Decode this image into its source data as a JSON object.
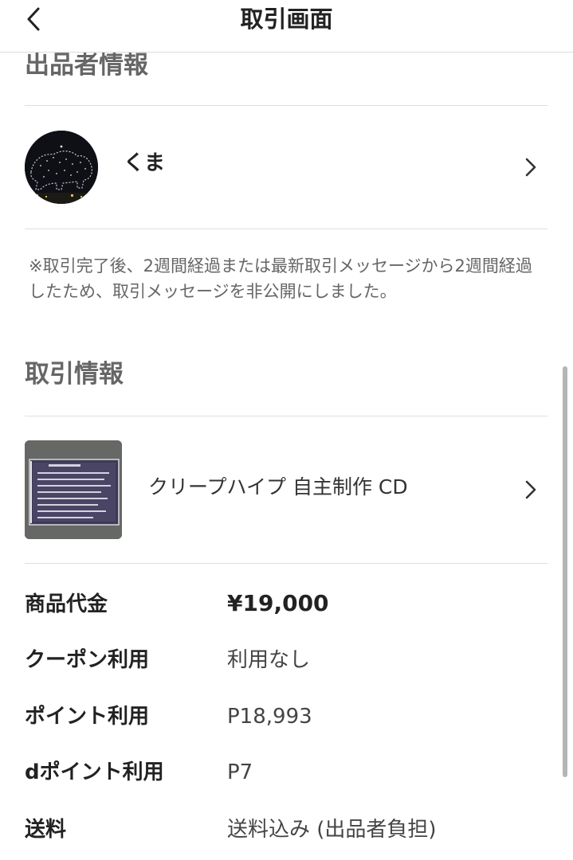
{
  "header": {
    "title": "取引画面"
  },
  "seller_section": {
    "title": "出品者情報",
    "seller_name": "くま"
  },
  "notice": "※取引完了後、2週間経過または最新取引メッセージから2週間経過したため、取引メッセージを非公開にしました。",
  "trade_section": {
    "title": "取引情報",
    "item_name": "クリープハイプ 自主制作 CD"
  },
  "details": [
    {
      "label": "商品代金",
      "value": "¥19,000"
    },
    {
      "label": "クーポン利用",
      "value": "利用なし"
    },
    {
      "label": "ポイント利用",
      "value": "P18,993"
    },
    {
      "label": "dポイント利用",
      "value": "P7"
    },
    {
      "label": "送料",
      "value": "送料込み (出品者負担)"
    }
  ],
  "colors": {
    "section_title": "#666666",
    "divider": "#dedede",
    "text": "#222222"
  }
}
